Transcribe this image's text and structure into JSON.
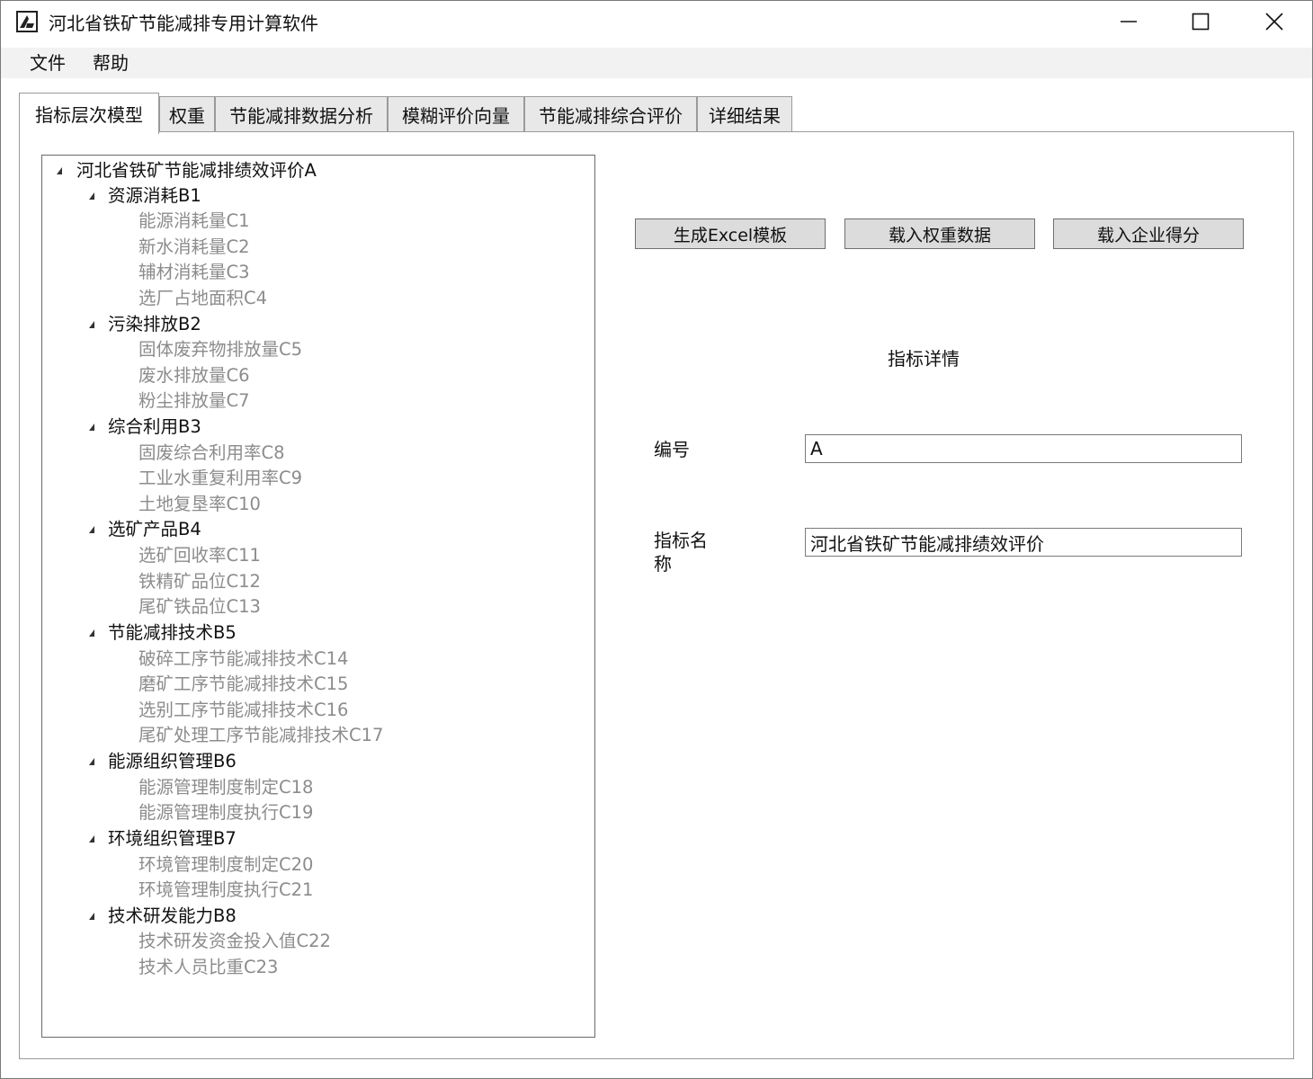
{
  "window": {
    "title": "河北省铁矿节能减排专用计算软件",
    "icon": "app-logo-icon",
    "controls": [
      "minimize-icon",
      "maximize-icon",
      "close-icon"
    ]
  },
  "menu": {
    "file": "文件",
    "help": "帮助"
  },
  "tabs": [
    {
      "label": "指标层次模型",
      "active": true
    },
    {
      "label": "权重",
      "active": false
    },
    {
      "label": "节能减排数据分析",
      "active": false
    },
    {
      "label": "模糊评价向量",
      "active": false
    },
    {
      "label": "节能减排综合评价",
      "active": false
    },
    {
      "label": "详细结果",
      "active": false
    }
  ],
  "tree": {
    "root": "河北省铁矿节能减排绩效评价A",
    "groups": [
      {
        "label": "资源消耗B1",
        "children": [
          "能源消耗量C1",
          "新水消耗量C2",
          "辅材消耗量C3",
          "选厂占地面积C4"
        ]
      },
      {
        "label": "污染排放B2",
        "children": [
          "固体废弃物排放量C5",
          "废水排放量C6",
          "粉尘排放量C7"
        ]
      },
      {
        "label": "综合利用B3",
        "children": [
          "固废综合利用率C8",
          "工业水重复利用率C9",
          "土地复垦率C10"
        ]
      },
      {
        "label": "选矿产品B4",
        "children": [
          "选矿回收率C11",
          "铁精矿品位C12",
          "尾矿铁品位C13"
        ]
      },
      {
        "label": "节能减排技术B5",
        "children": [
          "破碎工序节能减排技术C14",
          "磨矿工序节能减排技术C15",
          "选别工序节能减排技术C16",
          "尾矿处理工序节能减排技术C17"
        ]
      },
      {
        "label": "能源组织管理B6",
        "children": [
          "能源管理制度制定C18",
          "能源管理制度执行C19"
        ]
      },
      {
        "label": "环境组织管理B7",
        "children": [
          "环境管理制度制定C20",
          "环境管理制度执行C21"
        ]
      },
      {
        "label": "技术研发能力B8",
        "children": [
          "技术研发资金投入值C22",
          "技术人员比重C23"
        ]
      }
    ]
  },
  "buttons": {
    "generate_excel": "生成Excel模板",
    "load_weights": "载入权重数据",
    "load_scores": "载入企业得分"
  },
  "details": {
    "title": "指标详情",
    "id_label": "编号",
    "id_value": "A",
    "name_label": "指标名称",
    "name_value": "河北省铁矿节能减排绩效评价"
  }
}
